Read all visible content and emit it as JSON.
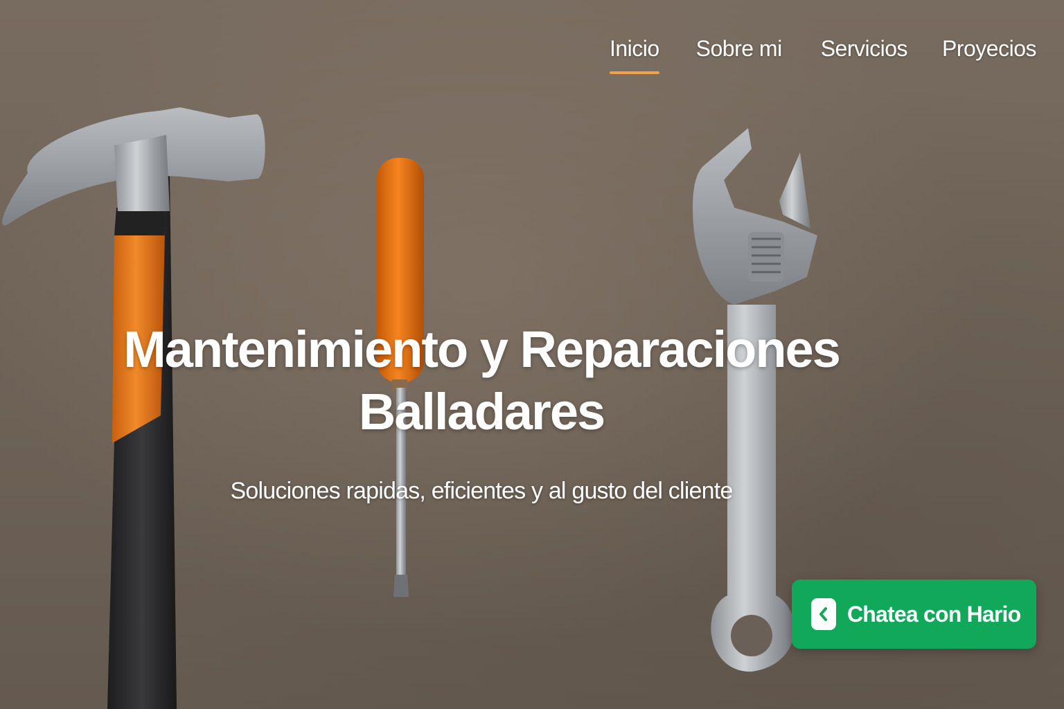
{
  "nav": {
    "items": [
      {
        "label": "Inicio",
        "active": true
      },
      {
        "label": "Sobre mi",
        "active": false
      },
      {
        "label": "Servicios",
        "active": false
      },
      {
        "label": "Proyecios",
        "active": false
      }
    ],
    "active_color": "#f2a04a"
  },
  "hero": {
    "title_line1": "Mantenimiento y Reparaciones",
    "title_line2": "Balladares",
    "subtitle": "Soluciones rapidas, eficientes y al gusto del cliente",
    "background_image": "hammer-screwdriver-wrench-on-wood"
  },
  "chat": {
    "label": "Chatea con Hario",
    "color": "#12a85a",
    "icon": "chevron-left-icon"
  }
}
